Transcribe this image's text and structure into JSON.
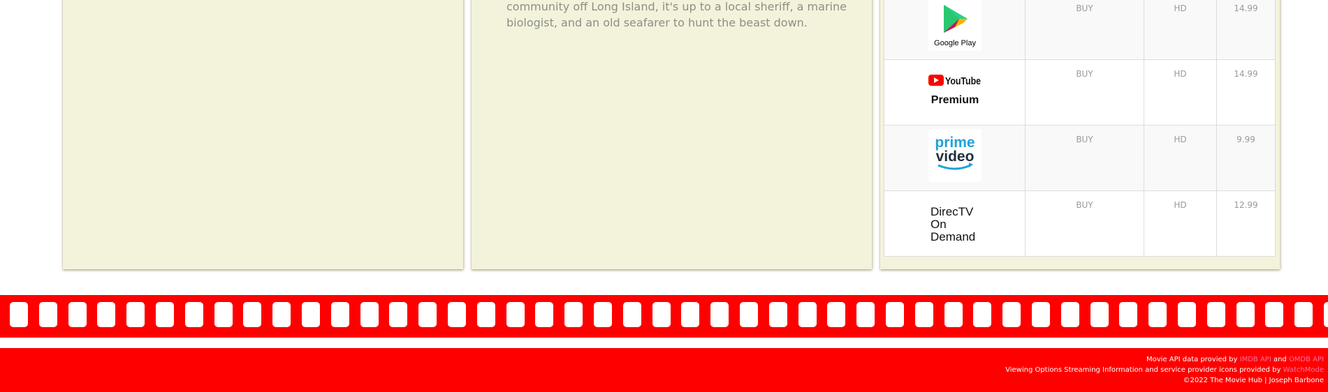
{
  "synopsis": {
    "line1": "community off Long Island, it's up to a local sheriff, a marine",
    "line2": "biologist, and an old seafarer to hunt the beast down."
  },
  "providers": [
    {
      "name": "Google Play",
      "logo": "google-play-logo",
      "type": "BUY",
      "quality": "HD",
      "price": "14.99"
    },
    {
      "name": "YouTube Premium",
      "logo": "youtube-premium-logo",
      "type": "BUY",
      "quality": "HD",
      "price": "14.99"
    },
    {
      "name": "prime video",
      "logo": "prime-video-logo",
      "type": "BUY",
      "quality": "HD",
      "price": "9.99"
    },
    {
      "name": "DirecTV On Demand",
      "logo": "directv-on-demand-logo",
      "type": "BUY",
      "quality": "HD",
      "price": "12.99"
    }
  ],
  "logos": {
    "google_play_text": "Google Play",
    "youtube_text": "YouTube",
    "youtube_premium_text": "Premium",
    "prime_text": "prime",
    "video_text": "video",
    "directv_line1": "DirecTV",
    "directv_line2": "On",
    "directv_line3": "Demand"
  },
  "footer": {
    "line1_prefix": "Movie API data provied by ",
    "imdb_link": "IMDB API",
    "and": " and ",
    "omdb_link": "OMDB API",
    "line2_prefix": "Viewing Options Streaming Information and service provider icons provided by ",
    "watchmode_link": "WatchMode",
    "line3": "©2022 The Movie Hub | Joseph Barbone"
  },
  "colors": {
    "accent_red": "#fe0000",
    "panel_bg": "#f3f3dc",
    "link_pink": "#ff6fa0"
  }
}
